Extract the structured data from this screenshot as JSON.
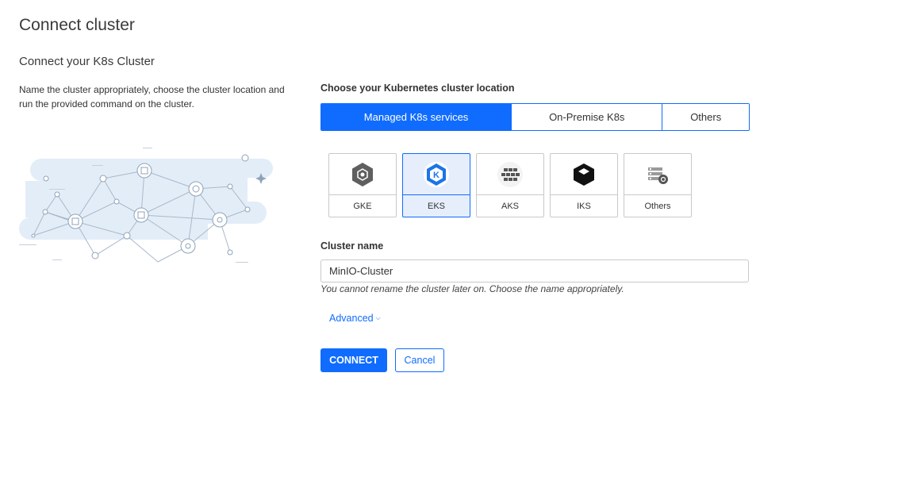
{
  "page": {
    "title": "Connect cluster",
    "section_title": "Connect your K8s Cluster",
    "description": "Name the cluster appropriately, choose the cluster location and run the provided command on the cluster."
  },
  "location": {
    "label": "Choose your Kubernetes cluster location",
    "options": [
      {
        "label": "Managed K8s services",
        "active": true
      },
      {
        "label": "On-Premise K8s",
        "active": false
      },
      {
        "label": "Others",
        "active": false
      }
    ]
  },
  "providers": [
    {
      "label": "GKE",
      "icon": "gke-icon",
      "selected": false
    },
    {
      "label": "EKS",
      "icon": "eks-icon",
      "selected": true
    },
    {
      "label": "AKS",
      "icon": "aks-icon",
      "selected": false
    },
    {
      "label": "IKS",
      "icon": "iks-icon",
      "selected": false
    },
    {
      "label": "Others",
      "icon": "others-provider-icon",
      "selected": false
    }
  ],
  "cluster_name": {
    "label": "Cluster name",
    "value": "MinIO-Cluster",
    "help": "You cannot rename the cluster later on. Choose the name appropriately."
  },
  "advanced": {
    "label": "Advanced",
    "icon": "chevron-down-icon"
  },
  "actions": {
    "connect_label": "CONNECT",
    "cancel_label": "Cancel"
  },
  "colors": {
    "primary": "#0f6cff",
    "selected_bg": "#e6eefc",
    "illustration_bg": "#e3edf8"
  }
}
